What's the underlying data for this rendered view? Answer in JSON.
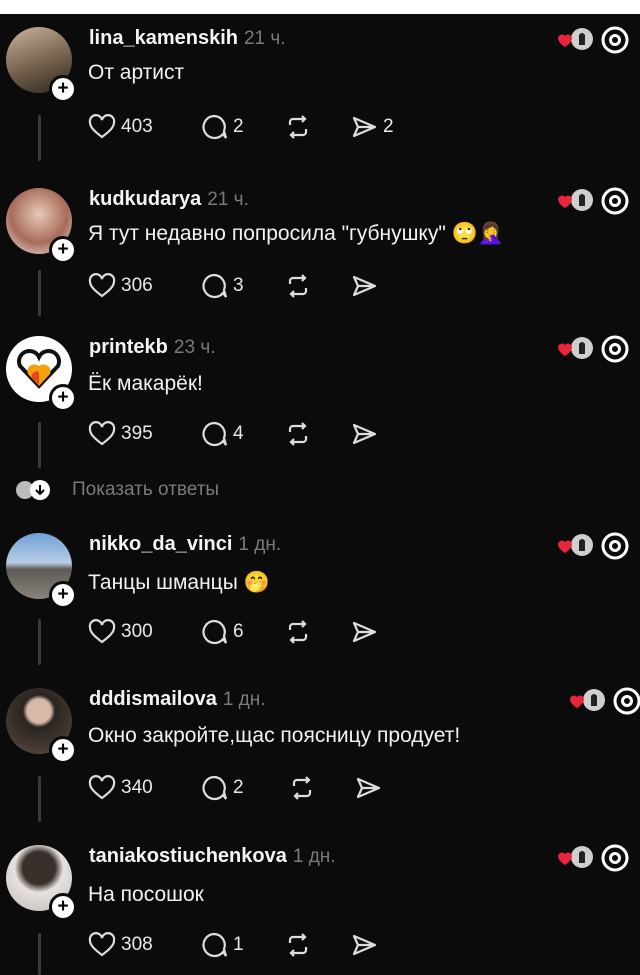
{
  "posts": [
    {
      "username": "lina_kamenskih",
      "time": "21 ч.",
      "text": "От артист",
      "likes": "403",
      "replies": "2",
      "shares": "2",
      "emoji": ""
    },
    {
      "username": "kudkudarya",
      "time": "21 ч.",
      "text": "Я тут недавно попросила \"губнушку\"",
      "likes": "306",
      "replies": "3",
      "shares": "",
      "emoji": "🙄🤦‍♀️"
    },
    {
      "username": "printekb",
      "time": "23 ч.",
      "text": "Ёк макарёк!",
      "likes": "395",
      "replies": "4",
      "shares": "",
      "emoji": ""
    },
    {
      "username": "nikko_da_vinci",
      "time": "1 дн.",
      "text": "Танцы шманцы",
      "likes": "300",
      "replies": "6",
      "shares": "",
      "emoji": "🤭"
    },
    {
      "username": "dddismailova",
      "time": "1 дн.",
      "text": "Окно закройте,щас поясницу продует!",
      "likes": "340",
      "replies": "2",
      "shares": "",
      "emoji": ""
    },
    {
      "username": "taniakostiuchenkova",
      "time": "1 дн.",
      "text": "На посошок",
      "likes": "308",
      "replies": "1",
      "shares": "",
      "emoji": ""
    }
  ],
  "show_replies_label": "Показать ответы",
  "colors": {
    "background": "#0b0b0b",
    "heart": "#e8263a",
    "muted": "#7a7a7a",
    "thread_line": "#3a3a3a"
  },
  "icons": {
    "like": "heart-outline-icon",
    "reply": "speech-bubble-icon",
    "repost": "repost-icon",
    "share": "send-icon",
    "liked_by_author": "liked-by-author-icon",
    "threads": "threads-logo-icon"
  }
}
